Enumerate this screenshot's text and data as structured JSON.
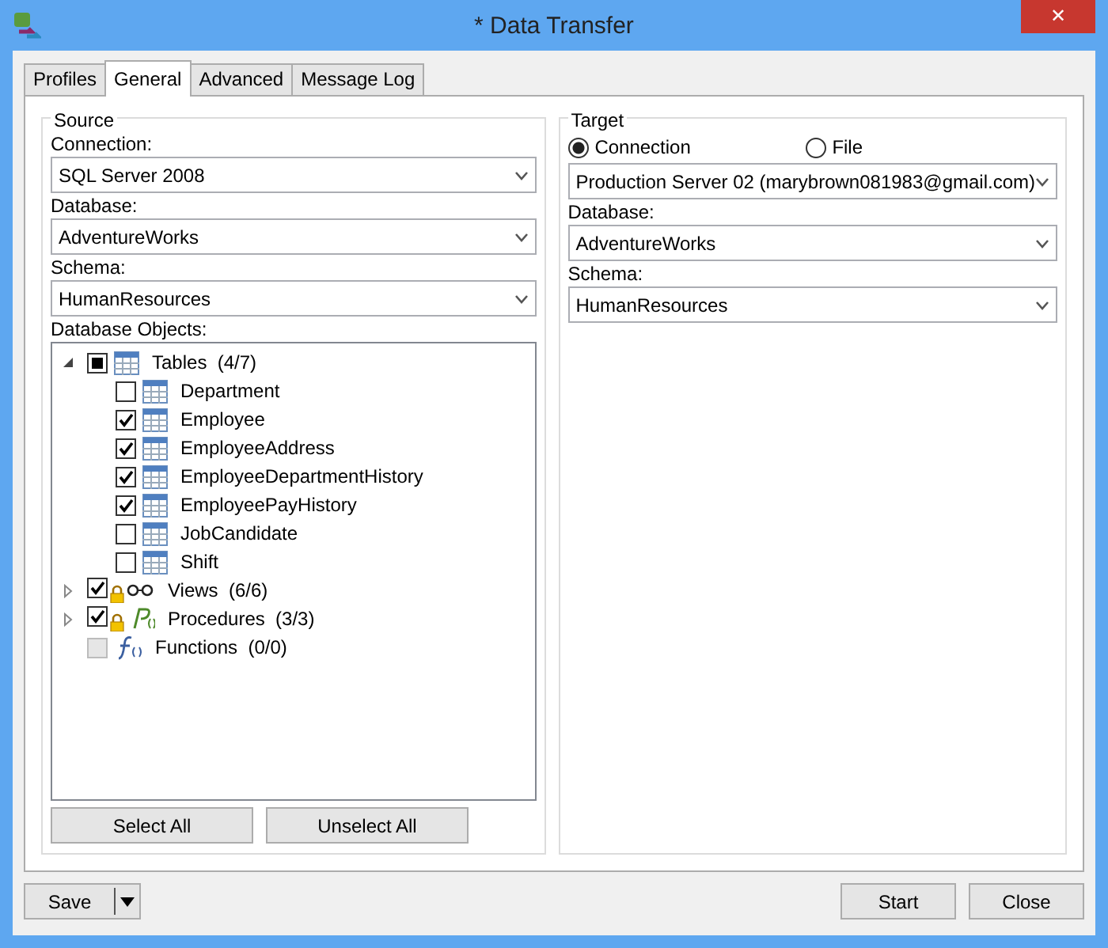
{
  "window": {
    "title": "* Data Transfer",
    "close": "✕"
  },
  "tabs": [
    {
      "label": "Profiles",
      "selected": false
    },
    {
      "label": "General",
      "selected": true
    },
    {
      "label": "Advanced",
      "selected": false
    },
    {
      "label": "Message Log",
      "selected": false
    }
  ],
  "source": {
    "title": "Source",
    "connection_label": "Connection:",
    "connection": "SQL Server 2008",
    "database_label": "Database:",
    "database": "AdventureWorks",
    "schema_label": "Schema:",
    "schema": "HumanResources",
    "objects_label": "Database Objects:",
    "tree": [
      {
        "label": "Tables",
        "count": "(4/7)",
        "kind": "table",
        "checked": false,
        "partial": true,
        "locked": false,
        "disabled": false,
        "expanded": true,
        "children": [
          {
            "label": "Department",
            "kind": "table",
            "checked": false,
            "partial": false,
            "locked": false,
            "disabled": false
          },
          {
            "label": "Employee",
            "kind": "table",
            "checked": true,
            "partial": false,
            "locked": false,
            "disabled": false
          },
          {
            "label": "EmployeeAddress",
            "kind": "table",
            "checked": true,
            "partial": false,
            "locked": false,
            "disabled": false
          },
          {
            "label": "EmployeeDepartmentHistory",
            "kind": "table",
            "checked": true,
            "partial": false,
            "locked": false,
            "disabled": false
          },
          {
            "label": "EmployeePayHistory",
            "kind": "table",
            "checked": true,
            "partial": false,
            "locked": false,
            "disabled": false
          },
          {
            "label": "JobCandidate",
            "kind": "table",
            "checked": false,
            "partial": false,
            "locked": false,
            "disabled": false
          },
          {
            "label": "Shift",
            "kind": "table",
            "checked": false,
            "partial": false,
            "locked": false,
            "disabled": false
          }
        ]
      },
      {
        "label": "Views",
        "count": "(6/6)",
        "kind": "view",
        "checked": true,
        "partial": false,
        "locked": true,
        "disabled": false,
        "expanded": false
      },
      {
        "label": "Procedures",
        "count": "(3/3)",
        "kind": "procedure",
        "checked": true,
        "partial": false,
        "locked": true,
        "disabled": false,
        "expanded": false
      },
      {
        "label": "Functions",
        "count": "(0/0)",
        "kind": "function",
        "checked": false,
        "partial": false,
        "locked": false,
        "disabled": true
      }
    ],
    "buttons": [
      "Select All",
      "Unselect All"
    ]
  },
  "target": {
    "title": "Target",
    "modes": [
      {
        "label": "Connection",
        "selected": true
      },
      {
        "label": "File",
        "selected": false
      }
    ],
    "connection": "Production Server 02 (marybrown081983@gmail.com)",
    "database_label": "Database:",
    "database": "AdventureWorks",
    "schema_label": "Schema:",
    "schema": "HumanResources"
  },
  "footer": {
    "save": "Save",
    "buttons": [
      "Start",
      "Close"
    ]
  }
}
